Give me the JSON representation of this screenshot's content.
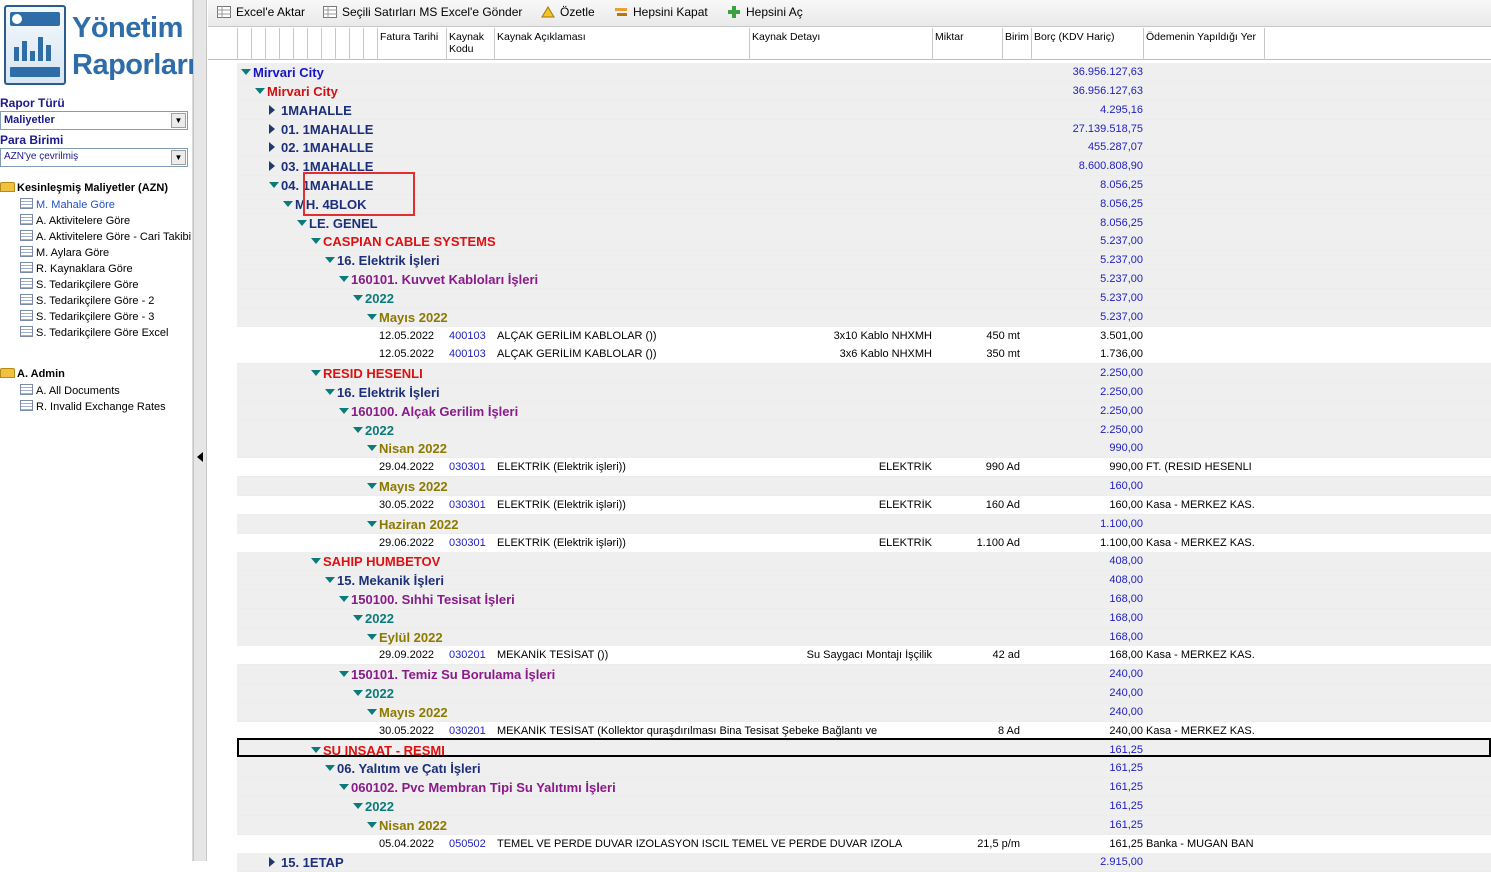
{
  "app": {
    "logo_line1": "Yönetim",
    "logo_line2": "Raporları"
  },
  "sidebar": {
    "report_type_label": "Rapor Türü",
    "report_type_value": "Maliyetler",
    "currency_label": "Para Birimi",
    "currency_value": "AZN'ye çevrilmiş",
    "folders": [
      {
        "label": "Kesinleşmiş Maliyetler (AZN)",
        "items": [
          "M. Mahale Göre",
          "A. Aktivitelere Göre",
          "A. Aktivitelere Göre - Cari Takibi",
          "M. Aylara Göre",
          "R. Kaynaklara Göre",
          "S. Tedarikçilere Göre",
          "S. Tedarikçilere Göre - 2",
          "S. Tedarikçilere Göre - 3",
          "S. Tedarikçilere Göre Excel"
        ]
      },
      {
        "label": "A. Admin",
        "items": [
          "A. All Documents",
          "R. Invalid Exchange Rates"
        ]
      }
    ]
  },
  "toolbar": {
    "export_excel": "Excel'e Aktar",
    "send_selected": "Seçili Satırları MS Excel'e Gönder",
    "summarize": "Özetle",
    "collapse_all": "Hepsini Kapat",
    "expand_all": "Hepsini Aç"
  },
  "columns": [
    "Fatura Tarihi",
    "Kaynak Kodu",
    "Kaynak Açıklaması",
    "Kaynak Detayı",
    "Miktar",
    "Birim",
    "Borç (KDV Hariç)",
    "Ödemenin Yapıldığı Yer"
  ],
  "colors": {
    "project": "#1515c8",
    "subproject": "#d01010",
    "region": "#1c2f7a",
    "supplier": "#e01010",
    "activity": "#1c2f7a",
    "resource": "#8a1a8a",
    "year": "#0a7a7a",
    "month": "#8c7a00"
  },
  "rows": [
    {
      "kind": "g",
      "lvl": 0,
      "open": true,
      "text": "Mirvari City",
      "cls": "project",
      "amount": "36.956.127,63"
    },
    {
      "kind": "g",
      "lvl": 1,
      "open": true,
      "text": "Mirvari City",
      "cls": "subproject",
      "amount": "36.956.127,63"
    },
    {
      "kind": "g",
      "lvl": 2,
      "open": false,
      "text": " 1MAHALLE",
      "cls": "region",
      "amount": "4.295,16"
    },
    {
      "kind": "g",
      "lvl": 2,
      "open": false,
      "text": "01. 1MAHALLE",
      "cls": "region",
      "amount": "27.139.518,75"
    },
    {
      "kind": "g",
      "lvl": 2,
      "open": false,
      "text": "02. 1MAHALLE",
      "cls": "region",
      "amount": "455.287,07"
    },
    {
      "kind": "g",
      "lvl": 2,
      "open": false,
      "text": "03. 1MAHALLE",
      "cls": "region",
      "amount": "8.600.808,90"
    },
    {
      "kind": "g",
      "lvl": 2,
      "open": true,
      "text": "04. 1MAHALLE",
      "cls": "region",
      "amount": "8.056,25"
    },
    {
      "kind": "g",
      "lvl": 3,
      "open": true,
      "text": "MH. 4BLOK",
      "cls": "region",
      "amount": "8.056,25"
    },
    {
      "kind": "g",
      "lvl": 4,
      "open": true,
      "text": "LE. GENEL",
      "cls": "region",
      "amount": "8.056,25"
    },
    {
      "kind": "g",
      "lvl": 5,
      "open": true,
      "text": "CASPIAN CABLE SYSTEMS",
      "cls": "supplier",
      "amount": "5.237,00"
    },
    {
      "kind": "g",
      "lvl": 6,
      "open": true,
      "text": "16. Elektrik İşleri",
      "cls": "activity",
      "amount": "5.237,00"
    },
    {
      "kind": "g",
      "lvl": 7,
      "open": true,
      "text": "160101. Kuvvet Kabloları İşleri",
      "cls": "resource",
      "amount": "5.237,00"
    },
    {
      "kind": "g",
      "lvl": 8,
      "open": true,
      "text": "2022",
      "cls": "year",
      "amount": "5.237,00"
    },
    {
      "kind": "g",
      "lvl": 9,
      "open": true,
      "text": "Mayıs 2022",
      "cls": "month",
      "amount": "5.237,00"
    },
    {
      "kind": "d",
      "date": "12.05.2022",
      "code": "400103",
      "desc": "ALÇAK GERİLİM KABLOLAR ())",
      "detail": "3x10 Kablo NHXMH",
      "qty": "450 mt",
      "amount": "3.501,00",
      "place": ""
    },
    {
      "kind": "d",
      "date": "12.05.2022",
      "code": "400103",
      "desc": "ALÇAK GERİLİM KABLOLAR ())",
      "detail": "3x6 Kablo NHXMH",
      "qty": "350 mt",
      "amount": "1.736,00",
      "place": ""
    },
    {
      "kind": "g",
      "lvl": 5,
      "open": true,
      "text": "RESID HESENLI",
      "cls": "supplier",
      "amount": "2.250,00"
    },
    {
      "kind": "g",
      "lvl": 6,
      "open": true,
      "text": "16. Elektrik İşleri",
      "cls": "activity",
      "amount": "2.250,00"
    },
    {
      "kind": "g",
      "lvl": 7,
      "open": true,
      "text": "160100. Alçak Gerilim İşleri",
      "cls": "resource",
      "amount": "2.250,00"
    },
    {
      "kind": "g",
      "lvl": 8,
      "open": true,
      "text": "2022",
      "cls": "year",
      "amount": "2.250,00"
    },
    {
      "kind": "g",
      "lvl": 9,
      "open": true,
      "text": "Nisan 2022",
      "cls": "month",
      "amount": "990,00"
    },
    {
      "kind": "d",
      "date": "29.04.2022",
      "code": "030301",
      "desc": "ELEKTRİK (Elektrik işleri))",
      "detail": "ELEKTRİK",
      "qty": "990 Ad",
      "amount": "990,00",
      "place": "FT. (RESID HESENLI"
    },
    {
      "kind": "g",
      "lvl": 9,
      "open": true,
      "text": "Mayıs 2022",
      "cls": "month",
      "amount": "160,00"
    },
    {
      "kind": "d",
      "date": "30.05.2022",
      "code": "030301",
      "desc": "ELEKTRİK (Elektrik işləri))",
      "detail": "ELEKTRİK",
      "qty": "160 Ad",
      "amount": "160,00",
      "place": "Kasa - MERKEZ KAS."
    },
    {
      "kind": "g",
      "lvl": 9,
      "open": true,
      "text": "Haziran 2022",
      "cls": "month",
      "amount": "1.100,00"
    },
    {
      "kind": "d",
      "date": "29.06.2022",
      "code": "030301",
      "desc": "ELEKTRİK (Elektrik işləri))",
      "detail": "ELEKTRİK",
      "qty": "1.100 Ad",
      "amount": "1.100,00",
      "place": "Kasa - MERKEZ KAS."
    },
    {
      "kind": "g",
      "lvl": 5,
      "open": true,
      "text": "SAHIP HUMBETOV",
      "cls": "supplier",
      "amount": "408,00"
    },
    {
      "kind": "g",
      "lvl": 6,
      "open": true,
      "text": "15. Mekanik  İşleri",
      "cls": "activity",
      "amount": "408,00"
    },
    {
      "kind": "g",
      "lvl": 7,
      "open": true,
      "text": "150100. Sıhhi Tesisat İşleri",
      "cls": "resource",
      "amount": "168,00"
    },
    {
      "kind": "g",
      "lvl": 8,
      "open": true,
      "text": "2022",
      "cls": "year",
      "amount": "168,00"
    },
    {
      "kind": "g",
      "lvl": 9,
      "open": true,
      "text": "Eylül 2022",
      "cls": "month",
      "amount": "168,00"
    },
    {
      "kind": "d",
      "date": "29.09.2022",
      "code": "030201",
      "desc": "MEKANİK TESİSAT ())",
      "detail": "Su Saygacı Montajı İşçilik",
      "qty": "42 ad",
      "amount": "168,00",
      "place": "Kasa - MERKEZ KAS."
    },
    {
      "kind": "g",
      "lvl": 7,
      "open": true,
      "text": "150101. Temiz Su Borulama İşleri",
      "cls": "resource",
      "amount": "240,00"
    },
    {
      "kind": "g",
      "lvl": 8,
      "open": true,
      "text": "2022",
      "cls": "year",
      "amount": "240,00"
    },
    {
      "kind": "g",
      "lvl": 9,
      "open": true,
      "text": "Mayıs 2022",
      "cls": "month",
      "amount": "240,00"
    },
    {
      "kind": "d",
      "date": "30.05.2022",
      "code": "030201",
      "desc": "MEKANİK TESİSAT (Kollektor quraşdırılması Bina Tesisat Şebeke Bağlantı ve",
      "detail": "",
      "qty": "8 Ad",
      "amount": "240,00",
      "place": "Kasa - MERKEZ KAS."
    },
    {
      "kind": "g",
      "lvl": 5,
      "open": true,
      "text": "SU INSAAT - RESMI",
      "cls": "supplier",
      "amount": "161,25"
    },
    {
      "kind": "g",
      "lvl": 6,
      "open": true,
      "text": "06. Yalıtım ve Çatı İşleri",
      "cls": "activity",
      "amount": "161,25"
    },
    {
      "kind": "g",
      "lvl": 7,
      "open": true,
      "text": "060102. Pvc Membran Tipi Su Yalıtımı İşleri",
      "cls": "resource",
      "amount": "161,25"
    },
    {
      "kind": "g",
      "lvl": 8,
      "open": true,
      "text": "2022",
      "cls": "year",
      "amount": "161,25"
    },
    {
      "kind": "g",
      "lvl": 9,
      "open": true,
      "text": "Nisan 2022",
      "cls": "month",
      "amount": "161,25"
    },
    {
      "kind": "d",
      "date": "05.04.2022",
      "code": "050502",
      "desc": "TEMEL VE PERDE DUVAR IZOLASYON ISCIL TEMEL VE PERDE DUVAR IZOLA",
      "detail": "",
      "qty": "21,5 p/m",
      "amount": "161,25",
      "place": "Banka - MUGAN BAN"
    },
    {
      "kind": "g",
      "lvl": 2,
      "open": false,
      "text": "15. 1ETAP",
      "cls": "region",
      "amount": "2.915,00"
    }
  ]
}
